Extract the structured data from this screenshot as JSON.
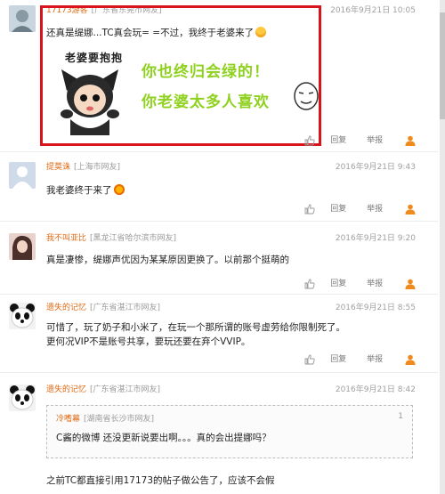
{
  "comments": [
    {
      "user": "17173游客",
      "location": "[广东省东莞市网友]",
      "time": "2016年9月21日 10:05",
      "text": "还真是缇娜...TC真会玩= =不过，我终于老婆来了",
      "sticker": {
        "title": "老婆要抱抱",
        "line1": "你也终归会绿的！",
        "line2": "你老婆太多人喜欢"
      }
    },
    {
      "user": "提莫诛",
      "location": "[上海市网友]",
      "time": "2016年9月21日 9:43",
      "text": "我老婆终于来了"
    },
    {
      "user": "我不叫亚比",
      "location": "[黑龙江省哈尔滨市网友]",
      "time": "2016年9月21日 9:20",
      "text": "真是凄惨，缇娜声优因为某某原因更换了。以前那个挺萌的"
    },
    {
      "user": "遗失的记忆",
      "location": "[广东省湛江市网友]",
      "time": "2016年9月21日 8:55",
      "text_line1": "可惜了，玩了奶子和小米了，在玩一个那所谓的账号虚劳给你限制死了。",
      "text_line2": "更何况VIP不是账号共享，要玩还要在弃个VVIP。"
    },
    {
      "user": "遗失的记忆",
      "location": "[广东省湛江市网友]",
      "time": "2016年9月21日 8:42",
      "quote": {
        "user": "冷嗜幕",
        "location": "[湖南省长沙市网友]",
        "floor": "1",
        "text": "C酱的微博 还没更新说要出啊。。。真的会出提娜吗？"
      },
      "text": "之前TC都直接引用17173的帖子做公告了，应该不会假"
    }
  ],
  "actions": {
    "reply": "回复",
    "report": "举报"
  },
  "colors": {
    "highlight_border": "#d9141c",
    "username": "#e06a14",
    "sticker_text": "#8ed11e",
    "action_user_icon": "#f08a1c"
  }
}
